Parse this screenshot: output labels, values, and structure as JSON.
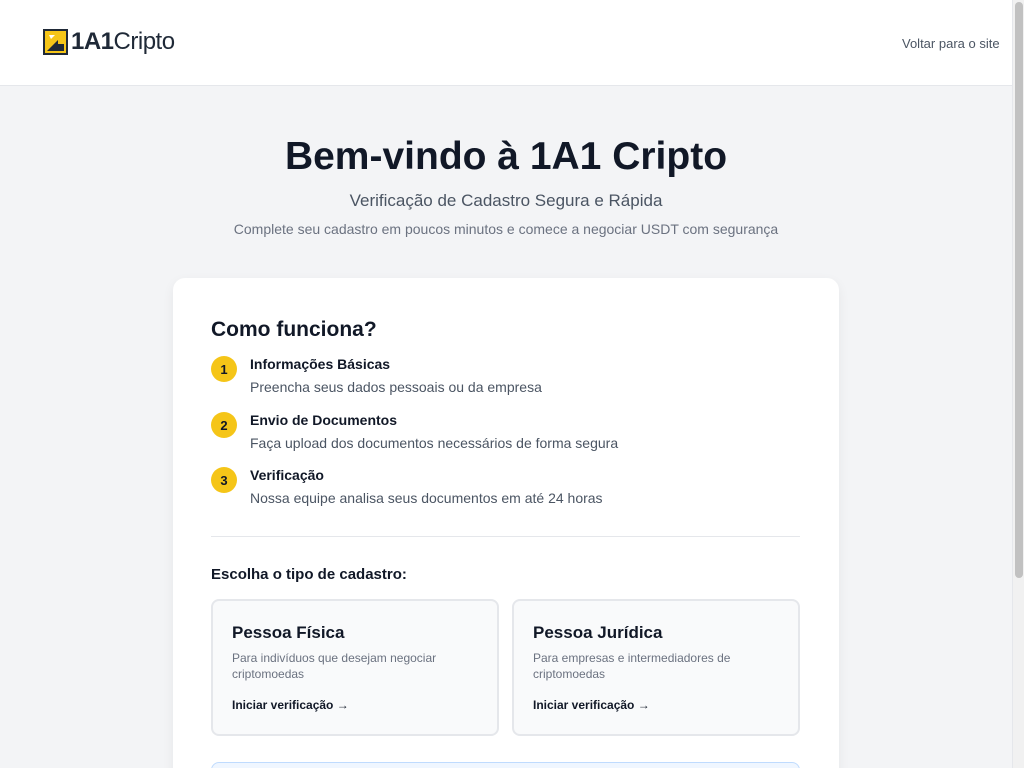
{
  "header": {
    "logo_text_bold": "1A1",
    "logo_text": "Cripto",
    "back_link": "Voltar para o site"
  },
  "hero": {
    "title": "Bem-vindo à 1A1 Cripto",
    "subtitle": "Verificação de Cadastro Segura e Rápida",
    "description": "Complete seu cadastro em poucos minutos e comece a negociar USDT com segurança"
  },
  "how": {
    "title": "Como funciona?",
    "steps": [
      {
        "num": "1",
        "title": "Informações Básicas",
        "desc": "Preencha seus dados pessoais ou da empresa"
      },
      {
        "num": "2",
        "title": "Envio de Documentos",
        "desc": "Faça upload dos documentos necessários de forma segura"
      },
      {
        "num": "3",
        "title": "Verificação",
        "desc": "Nossa equipe analisa seus documentos em até 24 horas"
      }
    ]
  },
  "choose": {
    "title": "Escolha o tipo de cadastro:",
    "options": [
      {
        "title": "Pessoa Física",
        "desc": "Para indivíduos que desejam negociar criptomoedas",
        "cta": "Iniciar verificação →"
      },
      {
        "title": "Pessoa Jurídica",
        "desc": "Para empresas e intermediadores de criptomoedas",
        "cta": "Iniciar verificação →"
      }
    ]
  },
  "colors": {
    "accent": "#f5c518",
    "background": "#f3f4f6",
    "text": "#111827"
  }
}
